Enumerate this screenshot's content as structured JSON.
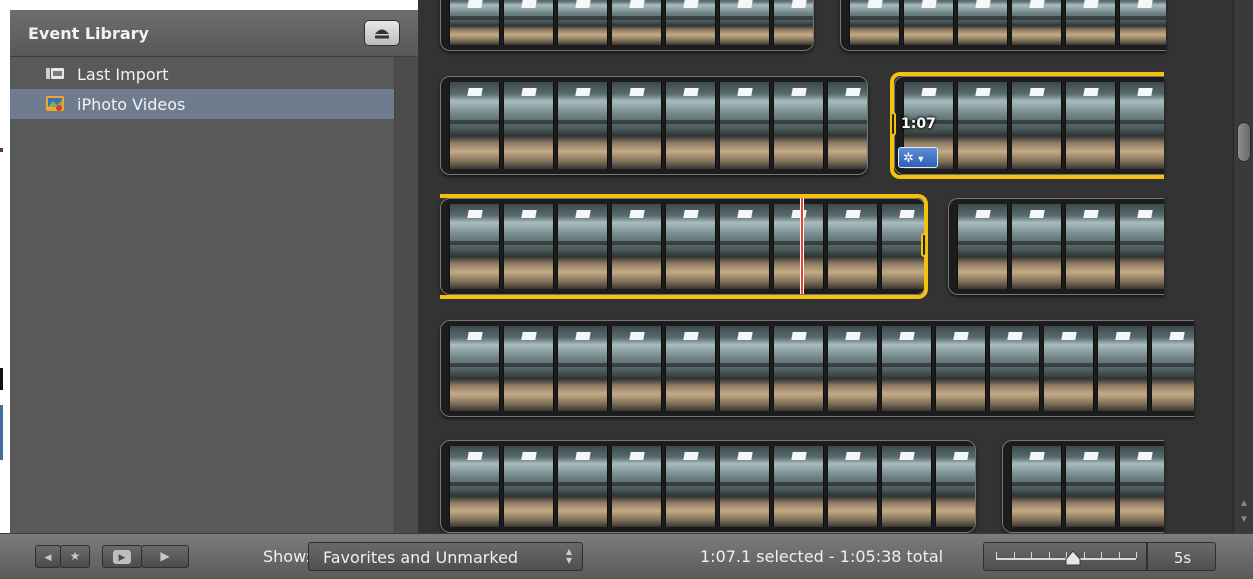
{
  "sidebar": {
    "title": "Event Library",
    "items": [
      {
        "label": "Last Import",
        "icon": "film-roll-icon",
        "selected": false
      },
      {
        "label": "iPhoto Videos",
        "icon": "iphoto-icon",
        "selected": true
      }
    ]
  },
  "clip": {
    "duration_label": "1:07",
    "action_icon": "gear-icon"
  },
  "toolbar": {
    "show_label": "Show:",
    "show_value": "Favorites and Unmarked",
    "status": "1:07.1 selected - 1:05:38 total",
    "zoom_value": "5s",
    "zoom_level": 0.55
  },
  "colors": {
    "selection": "#f2c20f",
    "playhead": "#e8422e",
    "sidebar_selected": "#6e7c8e"
  }
}
